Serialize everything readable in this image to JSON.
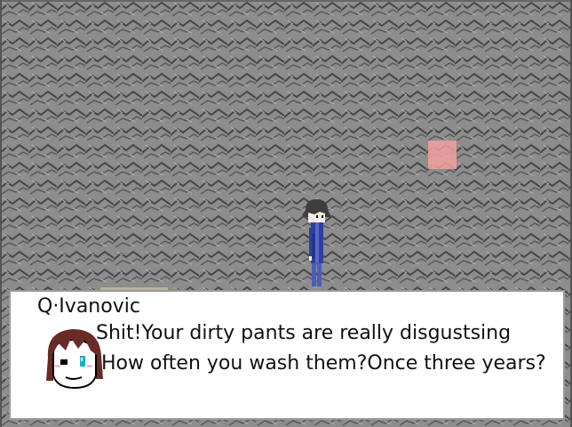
{
  "dialog": {
    "speaker": "Q·Ivanovic",
    "lines": [
      "Shit!Your dirty pants are really disgustsing",
      "How often you wash them?Once three years?"
    ]
  },
  "colors": {
    "floor": "#8a8a8a",
    "floor_pattern": "#4a4a4a",
    "event_tile": "#f2a0a0",
    "dialog_bg": "#ffffff",
    "portrait_hair": "#6a2a26",
    "portrait_eye": "#1ab0c8"
  },
  "icons": {
    "player": "boy-in-blue-uniform-sprite",
    "portrait": "girl-face-portrait-icon"
  }
}
